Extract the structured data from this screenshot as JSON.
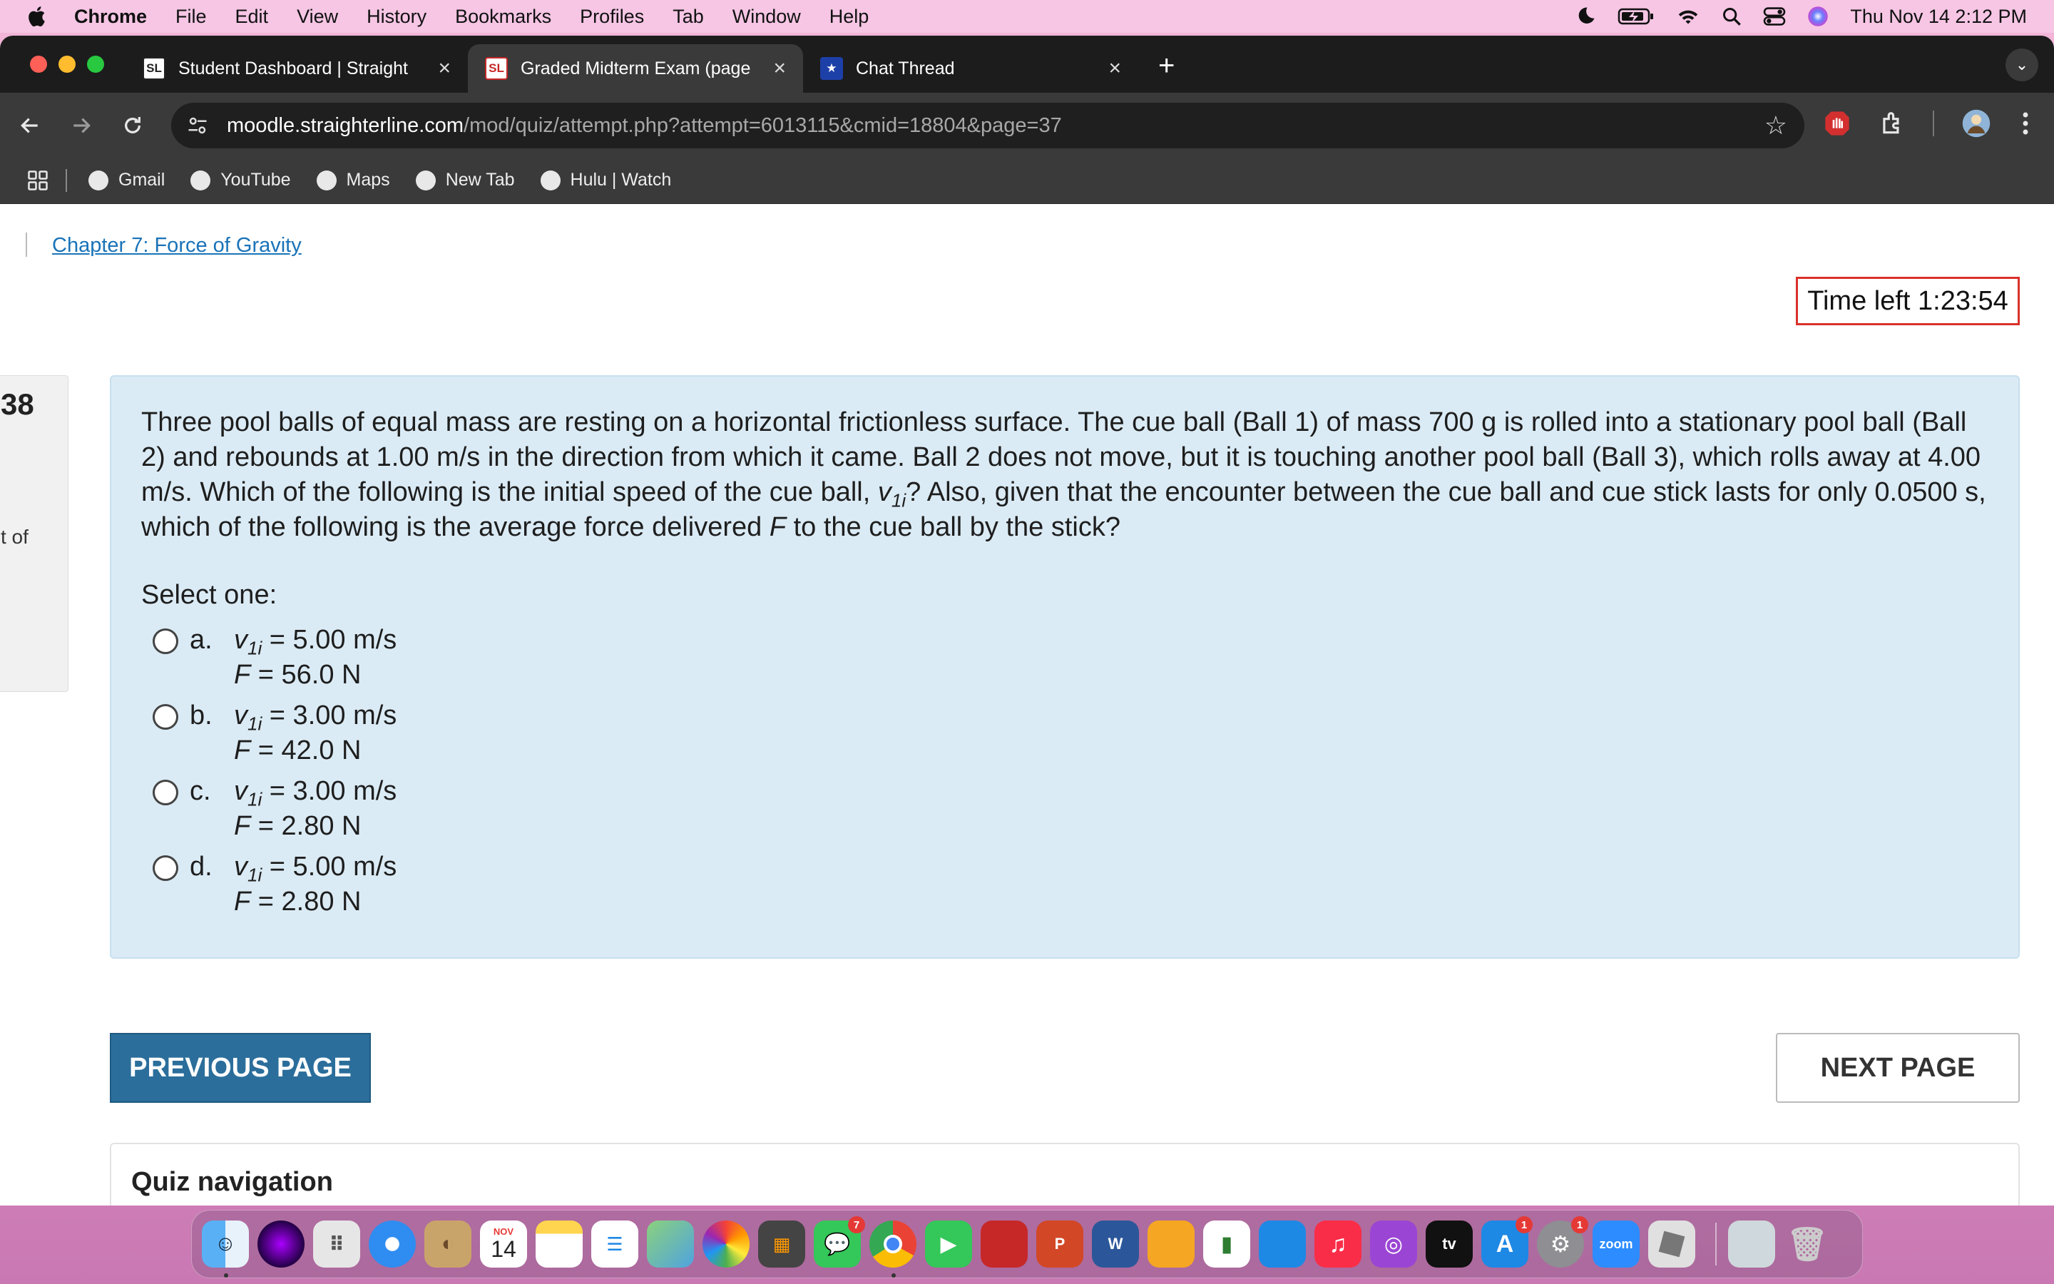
{
  "menubar": {
    "app": "Chrome",
    "items": [
      "File",
      "Edit",
      "View",
      "History",
      "Bookmarks",
      "Profiles",
      "Tab",
      "Window",
      "Help"
    ],
    "datetime": "Thu Nov 14  2:12 PM"
  },
  "tabs": [
    {
      "label": "Student Dashboard | Straight",
      "favicon": "SL"
    },
    {
      "label": "Graded Midterm Exam (page",
      "favicon": "SL"
    },
    {
      "label": "Chat Thread",
      "favicon": "★"
    }
  ],
  "address": {
    "host": "moodle.straighterline.com",
    "path": "/mod/quiz/attempt.php?attempt=6013115&cmid=18804&page=37"
  },
  "bookmarks": [
    "Gmail",
    "YouTube",
    "Maps",
    "New Tab",
    "Hulu | Watch"
  ],
  "page": {
    "breadcrumb": "Chapter 7: Force of Gravity",
    "timer": "Time left 1:23:54",
    "question_number": "38",
    "question_sidebar_text": "t of",
    "question": {
      "part1": "Three pool balls of equal mass are resting on a horizontal frictionless surface. The cue ball (Ball 1) of mass 700 g is rolled into a stationary pool ball (Ball 2) and rebounds at 1.00 m/s in the direction from which it came. Ball 2 does not move, but it is touching another pool ball (Ball 3), which rolls away at 4.00 m/s. Which of the following is the initial speed of the cue ball, ",
      "var_v": "v",
      "var_sub": "1i",
      "part2": "? Also, given that the encounter between the cue ball and cue stick lasts for only 0.0500 s, which of the following is the average force delivered ",
      "var_f": "F",
      "part3": " to the cue ball by the stick?"
    },
    "select_label": "Select one:",
    "options": [
      {
        "letter": "a.",
        "v": "v",
        "sub": "1i",
        "v_value": " = 5.00 m/s",
        "f": "F",
        "f_value": " = 56.0 N"
      },
      {
        "letter": "b.",
        "v": "v",
        "sub": "1i",
        "v_value": " = 3.00 m/s",
        "f": "F",
        "f_value": " = 42.0 N"
      },
      {
        "letter": "c.",
        "v": "v",
        "sub": "1i",
        "v_value": " = 3.00 m/s",
        "f": "F",
        "f_value": " = 2.80 N"
      },
      {
        "letter": "d.",
        "v": "v",
        "sub": "1i",
        "v_value": " = 5.00 m/s",
        "f": "F",
        "f_value": " = 2.80 N"
      }
    ],
    "prev_label": "PREVIOUS PAGE",
    "next_label": "NEXT PAGE",
    "quiz_nav_title": "Quiz navigation"
  },
  "dock": {
    "calendar_month": "NOV",
    "calendar_day": "14",
    "messages_badge": "7",
    "appstore_badge": "1",
    "settings_badge": "1",
    "zoom_label": "zoom",
    "tv_label": "tv"
  }
}
